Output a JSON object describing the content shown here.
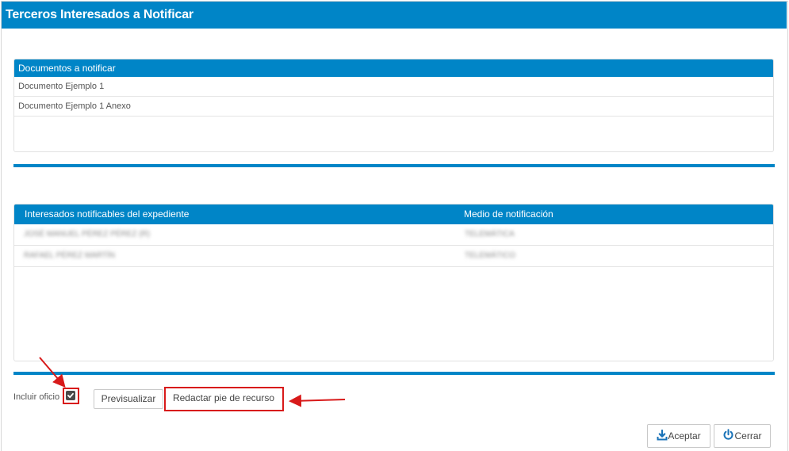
{
  "window": {
    "title": "Terceros Interesados a Notificar"
  },
  "documentos": {
    "header": "Documentos a notificar",
    "rows": [
      "Documento Ejemplo 1",
      "Documento Ejemplo 1 Anexo"
    ]
  },
  "interesados": {
    "col_interesados": "Interesados notificables del expediente",
    "col_medio": "Medio de notificación",
    "rows": [
      {
        "nombre": "JOSÉ MANUEL PÉREZ PÉREZ (R)",
        "medio": "TELEMÁTICA"
      },
      {
        "nombre": "RAFAEL PÉREZ MARTÍN",
        "medio": "TELEMÁTICO"
      }
    ]
  },
  "options": {
    "incluir_oficio_label": "Incluir oficio",
    "incluir_oficio_checked": true
  },
  "buttons": {
    "previsualizar": "Previsualizar",
    "redactar": "Redactar pie de recurso",
    "aceptar": "Aceptar",
    "cerrar": "Cerrar"
  },
  "colors": {
    "header_blue": "#0085c7",
    "annotation_red": "#d81a1a"
  },
  "icons": {
    "aceptar": "download-icon",
    "cerrar": "power-icon",
    "checkbox": "check-icon"
  }
}
